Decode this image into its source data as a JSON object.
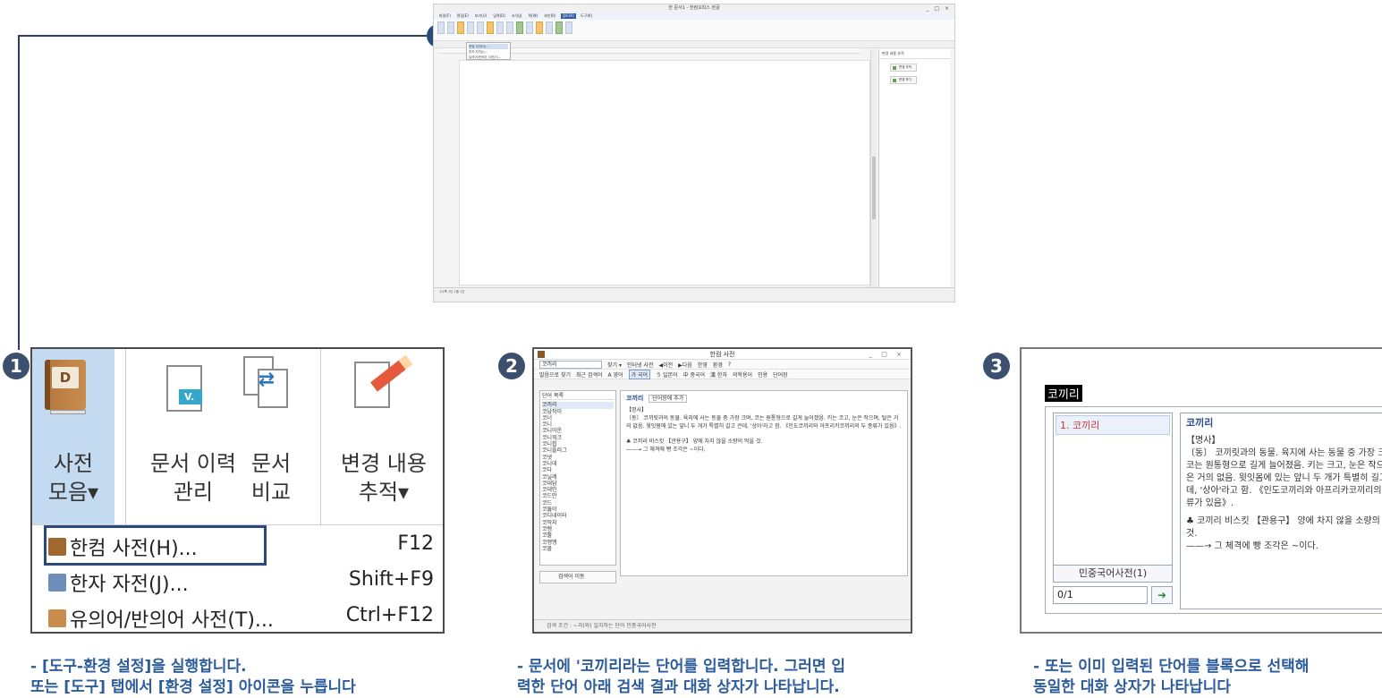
{
  "top_screenshot": {
    "title": "한 문서1 - 한컴오피스 한글",
    "menus": [
      "파일(F)",
      "편집(E)",
      "보기(U)",
      "입력(D)",
      "서식(J)",
      "쪽(W)",
      "보안(R)",
      "검토(H)",
      "도구(K)"
    ],
    "active_menu": "검토(H)",
    "dropdown_items": [
      "한컴 사전(H)...",
      "한자 자전(J)...",
      "유의어/반의어 사전(T)..."
    ],
    "side_panel_title": "변경 내용 추적",
    "side_buttons": [
      "변경 추적",
      "변경 보기"
    ],
    "status": "1/1쪽  1단  1줄  1칸"
  },
  "steps": [
    {
      "number": "1"
    },
    {
      "number": "2"
    },
    {
      "number": "3"
    }
  ],
  "panel1": {
    "ribbon": [
      {
        "label": "사전\n모음▾",
        "icon": "dictionary-book-icon"
      },
      {
        "label": "문서 이력\n관리",
        "icon": "document-history-icon"
      },
      {
        "label": "문서\n비교",
        "icon": "document-compare-icon"
      },
      {
        "label": "변경 내용\n추적▾",
        "icon": "track-changes-icon"
      }
    ],
    "book_letter": "D",
    "history_letter": "V.",
    "menu": [
      {
        "label": "한컴 사전(H)...",
        "shortcut": "F12",
        "icon": "hancom-dictionary-icon"
      },
      {
        "label": "한자 자전(J)...",
        "shortcut": "Shift+F9",
        "icon": "hanja-dictionary-icon"
      },
      {
        "label": "유의어/반의어 사전(T)...",
        "shortcut": "Ctrl+F12",
        "icon": "thesaurus-icon"
      }
    ]
  },
  "panel2": {
    "title": "한컴 사전",
    "window_buttons": "_ □ ×",
    "search_value": "코끼리",
    "toolbar1": [
      "찾기 ▾",
      "인터넷 사전",
      "◀이전",
      "▶다음",
      "한영",
      "환경",
      "?"
    ],
    "toolbar2": [
      "발음으로 찾기",
      "최근 검색어",
      "A 영어",
      "가 국어",
      "う 일본어",
      "中 중국어",
      "漢 한자",
      "의학용어",
      "인용",
      "단어장"
    ],
    "list_header": "단어 목록",
    "words": [
      "코끼리",
      "코납작이",
      "코너",
      "코니",
      "코니아운",
      "코니워크",
      "코니칩",
      "코니플러그",
      "코넷",
      "코니데",
      "코다",
      "코닐레",
      "코대답",
      "코데인",
      "코드만",
      "코드",
      "코뚫이",
      "코디네이터",
      "코딱지",
      "코렝",
      "코뿔",
      "코맹맹",
      "코몰"
    ],
    "add_button": "단어장에 추가",
    "entry_word": "코끼리",
    "entry_pos": "【명사】",
    "entry_def": "〔동〕 코끼릿과의 동물. 육지에 사는 동물 중 가장 크며, 코는 원통형으로 길게 늘어졌음. 키는 코고, 눈은 작으며, 털은 거의 없음. 윗잇몸에 있는 앞니 두 개가 특별히 길고 큰데, '상아'라고 함. 《인도코끼리와 아프리카코끼리의 두 종류가 있음》.",
    "entry_idiom": "♣ 코끼리 비스킷 【관용구】 양에 차지 않을 소량의 먹을 것.",
    "entry_ex": "——→ 그 체격에 빵 조각은 ~이다.",
    "move_button": "검색어 이동",
    "status": "검색 조건 : ~과(와) 일치하는 단어    민중국어사전"
  },
  "panel3": {
    "heading": "코끼리",
    "list_item": "1. 코끼리",
    "dict_button": "민중국어사전(1)",
    "page": "0/1",
    "page_button_icon": "next-page-icon",
    "entry_word": "코끼리",
    "entry_pos": "【명사】",
    "entry_def": "〔동〕 코끼릿과의 동물. 육지에 사는 동물 중 가장 크며, 코는 원통형으로 길게 늘어졌음. 키는 크고, 눈은 작으며, 털은 거의 없음. 윗잇몸에 있는 앞니 두 개가 특별히 길고 큰데, '상아'라고 함. 《인도코끼리와 아프리카코끼리의 두 종류가 있음》.",
    "entry_idiom": "♣ 코끼리 비스킷 【관용구】 양에 차지 않을 소량의 먹을 것.",
    "entry_ex": "——→ 그 체격에 빵 조각은 ~이다."
  },
  "captions": {
    "c1": "- [도구-환경 설정]을 실행합니다.\n또는 [도구] 탭에서 [환경 설정] 아이콘을 누릅니다",
    "c2": "- 문서에 '코끼리라는 단어를 입력합니다. 그러면 입\n력한 단어 아래 검색 결과 대화 상자가 나타납니다.",
    "c3": "- 또는 이미 입력된 단어를 블록으로 선택해\n동일한 대화 상자가 나타납니다"
  },
  "colors": {
    "accent": "#2b4a7c",
    "caption": "#2d5c9c",
    "ribbon_highlight": "#c4daf1"
  }
}
